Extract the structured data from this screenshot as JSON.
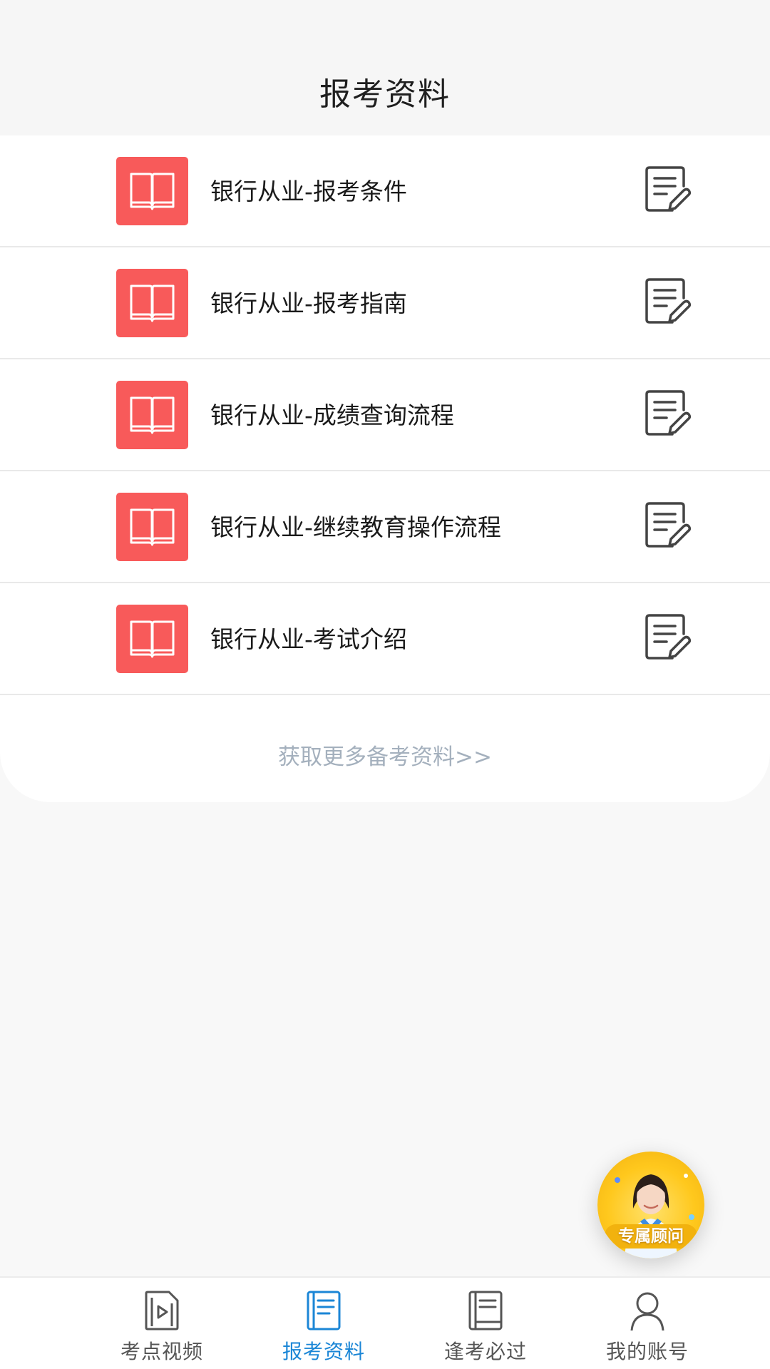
{
  "header": {
    "title": "报考资料"
  },
  "list": {
    "items": [
      {
        "label": "银行从业-报考条件"
      },
      {
        "label": "银行从业-报考指南"
      },
      {
        "label": "银行从业-成绩查询流程"
      },
      {
        "label": "银行从业-继续教育操作流程"
      },
      {
        "label": "银行从业-考试介绍"
      }
    ],
    "more_link": "获取更多备考资料>>"
  },
  "advisor": {
    "badge": "专属顾问"
  },
  "tabbar": {
    "tabs": [
      {
        "label": "考点视频",
        "icon": "video-doc-icon",
        "active": false
      },
      {
        "label": "报考资料",
        "icon": "book-doc-icon",
        "active": true
      },
      {
        "label": "逢考必过",
        "icon": "book-icon",
        "active": false
      },
      {
        "label": "我的账号",
        "icon": "user-icon",
        "active": false
      }
    ]
  },
  "colors": {
    "accent": "#1b86d6",
    "book_tile": "#f85a5a",
    "more_link": "#a4b0bd",
    "advisor": "#ffc81d"
  }
}
